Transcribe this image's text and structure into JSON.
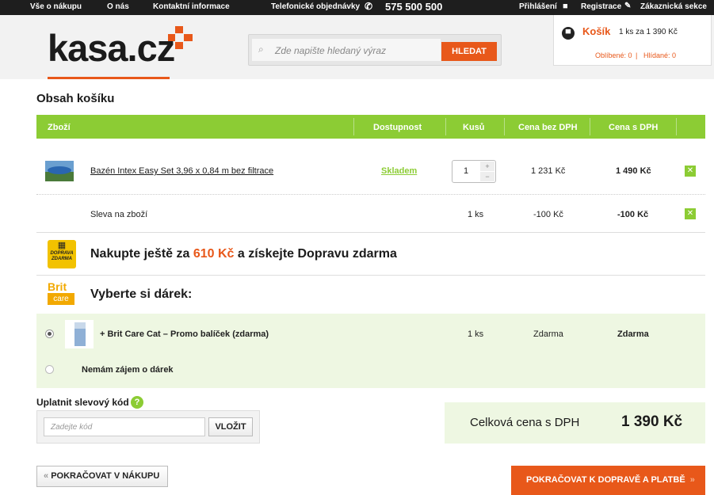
{
  "topbar": {
    "nav": [
      "Vše o nákupu",
      "O nás",
      "Kontaktní informace"
    ],
    "phone_label": "Telefonické objednávky",
    "phone_number": "575 500 500",
    "login": "Přihlášení",
    "register": "Registrace",
    "customer": "Zákaznická sekce"
  },
  "header": {
    "logo": "kasa.cz",
    "search_placeholder": "Zde napište hledaný výraz",
    "search_button": "HLEDAT",
    "cart_title": "Košík",
    "cart_summary": "1 ks za 1 390 Kč",
    "favorites": "Oblíbené: 0",
    "watched": "Hlídané: 0"
  },
  "cart": {
    "title": "Obsah košíku",
    "columns": [
      "Zboží",
      "Dostupnost",
      "Kusů",
      "Cena bez DPH",
      "Cena s DPH"
    ],
    "item": {
      "name": "Bazén Intex Easy Set 3,96 x 0,84 m bez filtrace",
      "availability": "Skladem",
      "qty": "1",
      "price_no_vat": "1 231 Kč",
      "price_vat": "1 490 Kč"
    },
    "discount": {
      "name": "Sleva na zboží",
      "qty": "1 ks",
      "price_no_vat": "-100 Kč",
      "price_vat": "-100 Kč"
    }
  },
  "promo": {
    "icon_text": "DOPRAVA ZDARMA",
    "text_before": "Nakupte ještě za",
    "amount": "610 Kč",
    "text_after": "a získejte Dopravu zdarma"
  },
  "gift": {
    "logo_top": "Brit",
    "logo_bottom": "care",
    "title": "Vyberte si dárek:",
    "option_name": "+ Brit Care Cat – Promo balíček (zdarma)",
    "option_qty": "1 ks",
    "option_price_no_vat": "Zdarma",
    "option_price_vat": "Zdarma",
    "no_gift": "Nemám zájem o dárek"
  },
  "coupon": {
    "label": "Uplatnit slevový kód",
    "placeholder": "Zadejte kód",
    "button": "VLOŽIT"
  },
  "total": {
    "label": "Celková cena s DPH",
    "value": "1 390 Kč"
  },
  "actions": {
    "continue_shopping": "POKRAČOVAT V NÁKUPU",
    "proceed": "POKRAČOVAT K DOPRAVĚ A PLATBĚ"
  },
  "colors": {
    "accent_orange": "#e8581a",
    "accent_green": "#8ccc34",
    "light_green": "#eef7e2"
  }
}
